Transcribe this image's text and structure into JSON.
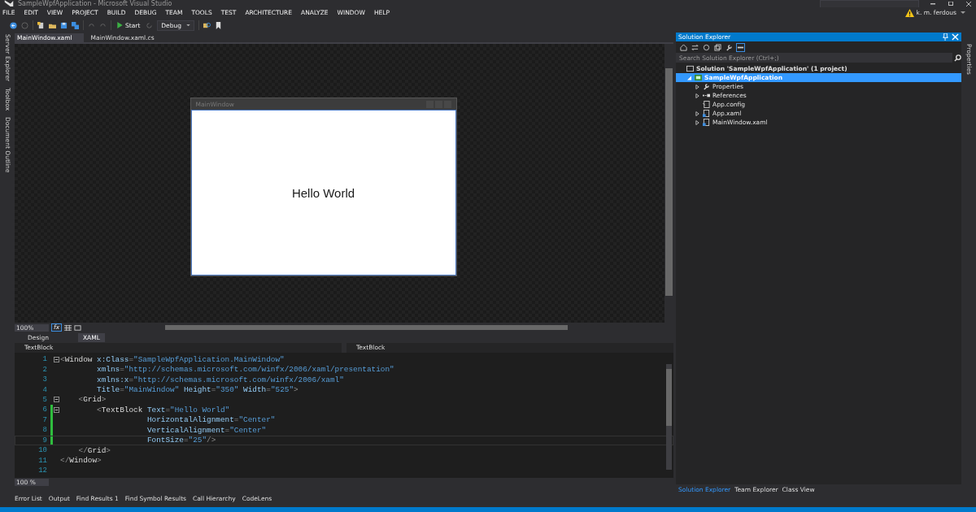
{
  "window": {
    "title": "SampleWpfApplication - Microsoft Visual Studio"
  },
  "menu": [
    "FILE",
    "EDIT",
    "VIEW",
    "PROJECT",
    "BUILD",
    "DEBUG",
    "TEAM",
    "TOOLS",
    "TEST",
    "ARCHITECTURE",
    "ANALYZE",
    "WINDOW",
    "HELP"
  ],
  "toolbar": {
    "start": "Start",
    "configuration": "Debug"
  },
  "account": {
    "user": "k. m. ferdous"
  },
  "left_dock_tabs": [
    "Server Explorer",
    "Toolbox",
    "Document Outline"
  ],
  "document_tabs": [
    {
      "label": "MainWindow.xaml",
      "selected": true
    },
    {
      "label": "MainWindow.xaml.cs",
      "selected": false
    }
  ],
  "designer": {
    "window_title": "MainWindow",
    "window_text": "Hello World",
    "zoom": "100%",
    "fx": "fx"
  },
  "view_tabs": [
    {
      "label": "Design",
      "selected": false
    },
    {
      "label": "XAML",
      "selected": true
    }
  ],
  "navigation": {
    "left": "TextBlock",
    "right": "TextBlock"
  },
  "editor": {
    "zoom": "100 %",
    "lines": [
      {
        "number": "1",
        "fold": true,
        "changed": false,
        "tokens": [
          {
            "kind": "punct",
            "text": "<"
          },
          {
            "kind": "element",
            "text": "Window"
          },
          {
            "kind": "attr",
            "text": " x:Class"
          },
          {
            "kind": "punct",
            "text": "="
          },
          {
            "kind": "value",
            "text": "\"SampleWpfApplication.MainWindow\""
          }
        ]
      },
      {
        "number": "2",
        "fold": false,
        "changed": false,
        "tokens": [
          {
            "kind": "attr",
            "text": "        xmlns"
          },
          {
            "kind": "punct",
            "text": "="
          },
          {
            "kind": "value",
            "text": "\"http://schemas.microsoft.com/winfx/2006/xaml/presentation\""
          }
        ]
      },
      {
        "number": "3",
        "fold": false,
        "changed": false,
        "tokens": [
          {
            "kind": "attr",
            "text": "        xmlns:x"
          },
          {
            "kind": "punct",
            "text": "="
          },
          {
            "kind": "value",
            "text": "\"http://schemas.microsoft.com/winfx/2006/xaml\""
          }
        ]
      },
      {
        "number": "4",
        "fold": false,
        "changed": false,
        "tokens": [
          {
            "kind": "attr",
            "text": "        Title"
          },
          {
            "kind": "punct",
            "text": "="
          },
          {
            "kind": "value",
            "text": "\"MainWindow\""
          },
          {
            "kind": "attr",
            "text": " Height"
          },
          {
            "kind": "punct",
            "text": "="
          },
          {
            "kind": "value",
            "text": "\"350\""
          },
          {
            "kind": "attr",
            "text": " Width"
          },
          {
            "kind": "punct",
            "text": "="
          },
          {
            "kind": "value",
            "text": "\"525\""
          },
          {
            "kind": "punct",
            "text": ">"
          }
        ]
      },
      {
        "number": "5",
        "fold": true,
        "changed": false,
        "tokens": [
          {
            "kind": "punct",
            "text": "    <"
          },
          {
            "kind": "element",
            "text": "Grid"
          },
          {
            "kind": "punct",
            "text": ">"
          }
        ]
      },
      {
        "number": "6",
        "fold": true,
        "changed": true,
        "tokens": [
          {
            "kind": "punct",
            "text": "        <"
          },
          {
            "kind": "element",
            "text": "TextBlock"
          },
          {
            "kind": "attr",
            "text": " Text"
          },
          {
            "kind": "punct",
            "text": "="
          },
          {
            "kind": "value",
            "text": "\"Hello World\""
          }
        ]
      },
      {
        "number": "7",
        "fold": false,
        "changed": true,
        "tokens": [
          {
            "kind": "attr",
            "text": "                   HorizontalAlignment"
          },
          {
            "kind": "punct",
            "text": "="
          },
          {
            "kind": "value",
            "text": "\"Center\""
          }
        ]
      },
      {
        "number": "8",
        "fold": false,
        "changed": true,
        "tokens": [
          {
            "kind": "attr",
            "text": "                   VerticalAlignment"
          },
          {
            "kind": "punct",
            "text": "="
          },
          {
            "kind": "value",
            "text": "\"Center\""
          }
        ]
      },
      {
        "number": "9",
        "fold": false,
        "changed": true,
        "tokens": [
          {
            "kind": "attr",
            "text": "                   FontSize"
          },
          {
            "kind": "punct",
            "text": "="
          },
          {
            "kind": "value",
            "text": "\"25\""
          },
          {
            "kind": "punct",
            "text": "/>"
          }
        ]
      },
      {
        "number": "10",
        "fold": false,
        "changed": false,
        "tokens": [
          {
            "kind": "punct",
            "text": "    </"
          },
          {
            "kind": "element",
            "text": "Grid"
          },
          {
            "kind": "punct",
            "text": ">"
          }
        ]
      },
      {
        "number": "11",
        "fold": false,
        "changed": false,
        "tokens": [
          {
            "kind": "punct",
            "text": "</"
          },
          {
            "kind": "element",
            "text": "Window"
          },
          {
            "kind": "punct",
            "text": ">"
          }
        ]
      },
      {
        "number": "12",
        "fold": false,
        "changed": false
      }
    ]
  },
  "tool_tabs": [
    "Error List",
    "Output",
    "Find Results 1",
    "Find Symbol Results",
    "Call Hierarchy",
    "CodeLens"
  ],
  "solution_explorer": {
    "title": "Solution Explorer",
    "search": {
      "placeholder": "Search Solution Explorer (Ctrl+;)"
    },
    "tree": [
      {
        "label": "Solution 'SampleWpfApplication' (1 project)",
        "kind": "solution",
        "selected": false,
        "children": [
          {
            "label": "SampleWpfApplication",
            "kind": "project",
            "expanded": true,
            "selected": true,
            "children": [
              {
                "label": "Properties",
                "kind": "properties",
                "expanded": false,
                "selected": false
              },
              {
                "label": "References",
                "kind": "references",
                "expanded": false,
                "selected": false
              },
              {
                "label": "App.config",
                "kind": "config",
                "selected": false
              },
              {
                "label": "App.xaml",
                "kind": "xaml",
                "expanded": false,
                "selected": false
              },
              {
                "label": "MainWindow.xaml",
                "kind": "xaml",
                "expanded": false,
                "selected": false
              }
            ]
          }
        ]
      }
    ],
    "tabs": [
      {
        "label": "Solution Explorer",
        "selected": true
      },
      {
        "label": "Team Explorer",
        "selected": false
      },
      {
        "label": "Class View",
        "selected": false
      }
    ]
  },
  "right_dock_tabs": [
    "Properties"
  ]
}
